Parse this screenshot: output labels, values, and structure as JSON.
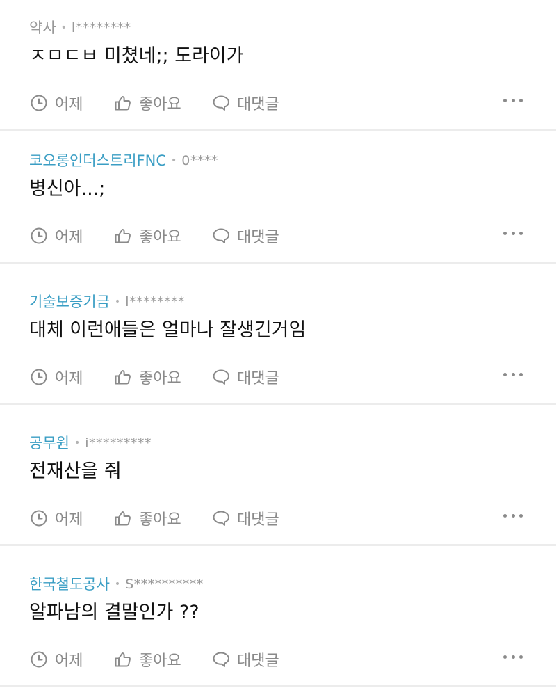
{
  "actions": {
    "time_label": "어제",
    "like_label": "좋아요",
    "reply_label": "대댓글"
  },
  "colors": {
    "verified_company": "#3a9ec4",
    "muted": "#999999",
    "body": "#111111"
  },
  "posts": [
    {
      "company": "약사",
      "verified": false,
      "user": "l********",
      "text": "ㅈㅁㄷㅂ 미쳤네;; 도라이가"
    },
    {
      "company": "코오롱인더스트리FNC",
      "verified": true,
      "user": "0****",
      "text": "병신아...;"
    },
    {
      "company": "기술보증기금",
      "verified": true,
      "user": "l********",
      "text": "대체 이런애들은 얼마나 잘생긴거임"
    },
    {
      "company": "공무원",
      "verified": true,
      "user": "i*********",
      "text": "전재산을 줘"
    },
    {
      "company": "한국철도공사",
      "verified": true,
      "user": "S**********",
      "text": "알파남의 결말인가 ??"
    }
  ]
}
